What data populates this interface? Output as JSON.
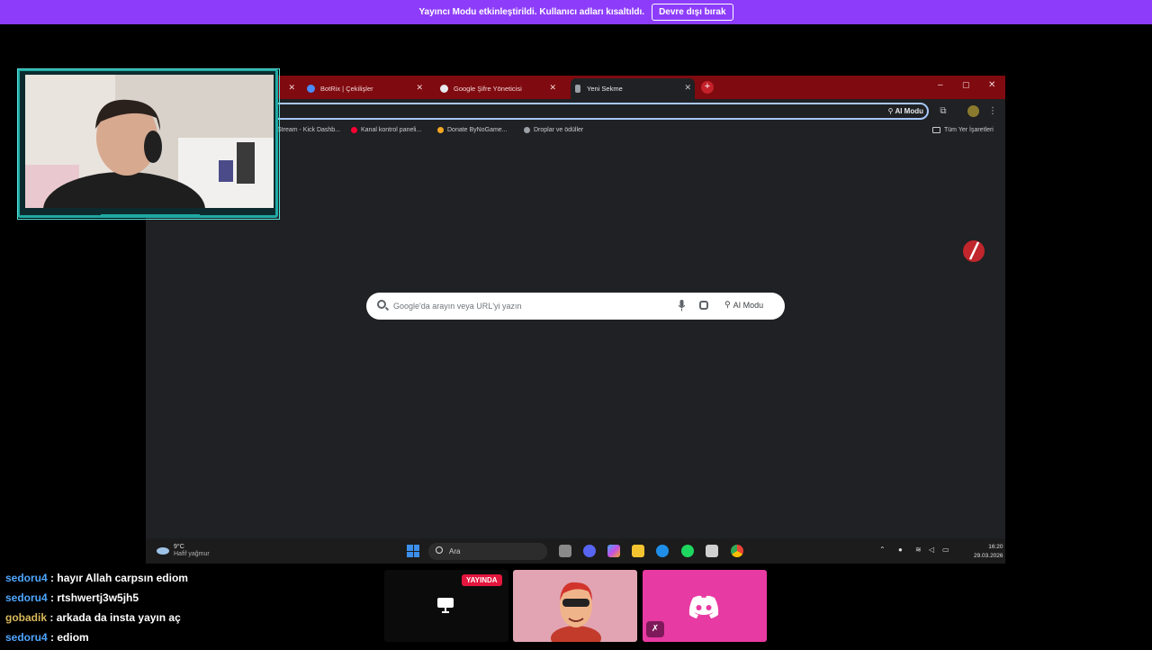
{
  "banner": {
    "text": "Yayıncı Modu etkinleştirildi. Kullanıcı adları kısaltıldı.",
    "button": "Devre dışı bırak"
  },
  "browser": {
    "tabs": [
      {
        "title": "",
        "active": false
      },
      {
        "title": "BotRix | Çekilişler",
        "active": false
      },
      {
        "title": "Google Şifre Yöneticisi",
        "active": false
      },
      {
        "title": "Yeni Sekme",
        "active": true
      }
    ],
    "new_tab": "+",
    "window_controls": [
      "–",
      "▢",
      "✕"
    ],
    "ai_mode_toolbar": "AI Modu",
    "bookmarks": [
      {
        "label": "Stream - Kick Dashb...",
        "color": "#53fc18"
      },
      {
        "label": "Kanal kontrol paneli...",
        "color": "#ff0033"
      },
      {
        "label": "Donate ByNoGame...",
        "color": "#f5a623"
      },
      {
        "label": "Droplar ve ödüller",
        "color": "#9aa0a6"
      }
    ],
    "all_bookmarks": "Tüm Yer İşaretleri",
    "search_placeholder": "Google'da arayın veya URL'yi yazın",
    "search_ai_mode": "AI Modu"
  },
  "taskbar": {
    "weather_temp": "9°C",
    "weather_condition": "Hafif yağmur",
    "search_label": "Ara",
    "time": "16:20",
    "date": "29.03.2026"
  },
  "chat": [
    {
      "user": "sedoru4",
      "message": "hayır Allah carpsın ediom",
      "color": "#4ea6ff"
    },
    {
      "user": "sedoru4",
      "message": "rtshwertj3w5jh5",
      "color": "#4ea6ff"
    },
    {
      "user": "gobadik",
      "message": "arkada da insta yayın aç",
      "color": "#d8b85a"
    },
    {
      "user": "sedoru4",
      "message": "ediom",
      "color": "#4ea6ff"
    }
  ],
  "call": {
    "live_badge": "YAYINDA"
  },
  "colors": {
    "banner": "#8d3dfa",
    "tabbar": "#7f0a0f",
    "webcam_frame": "#1fa9a3",
    "discord_tile": "#e83aa3"
  }
}
